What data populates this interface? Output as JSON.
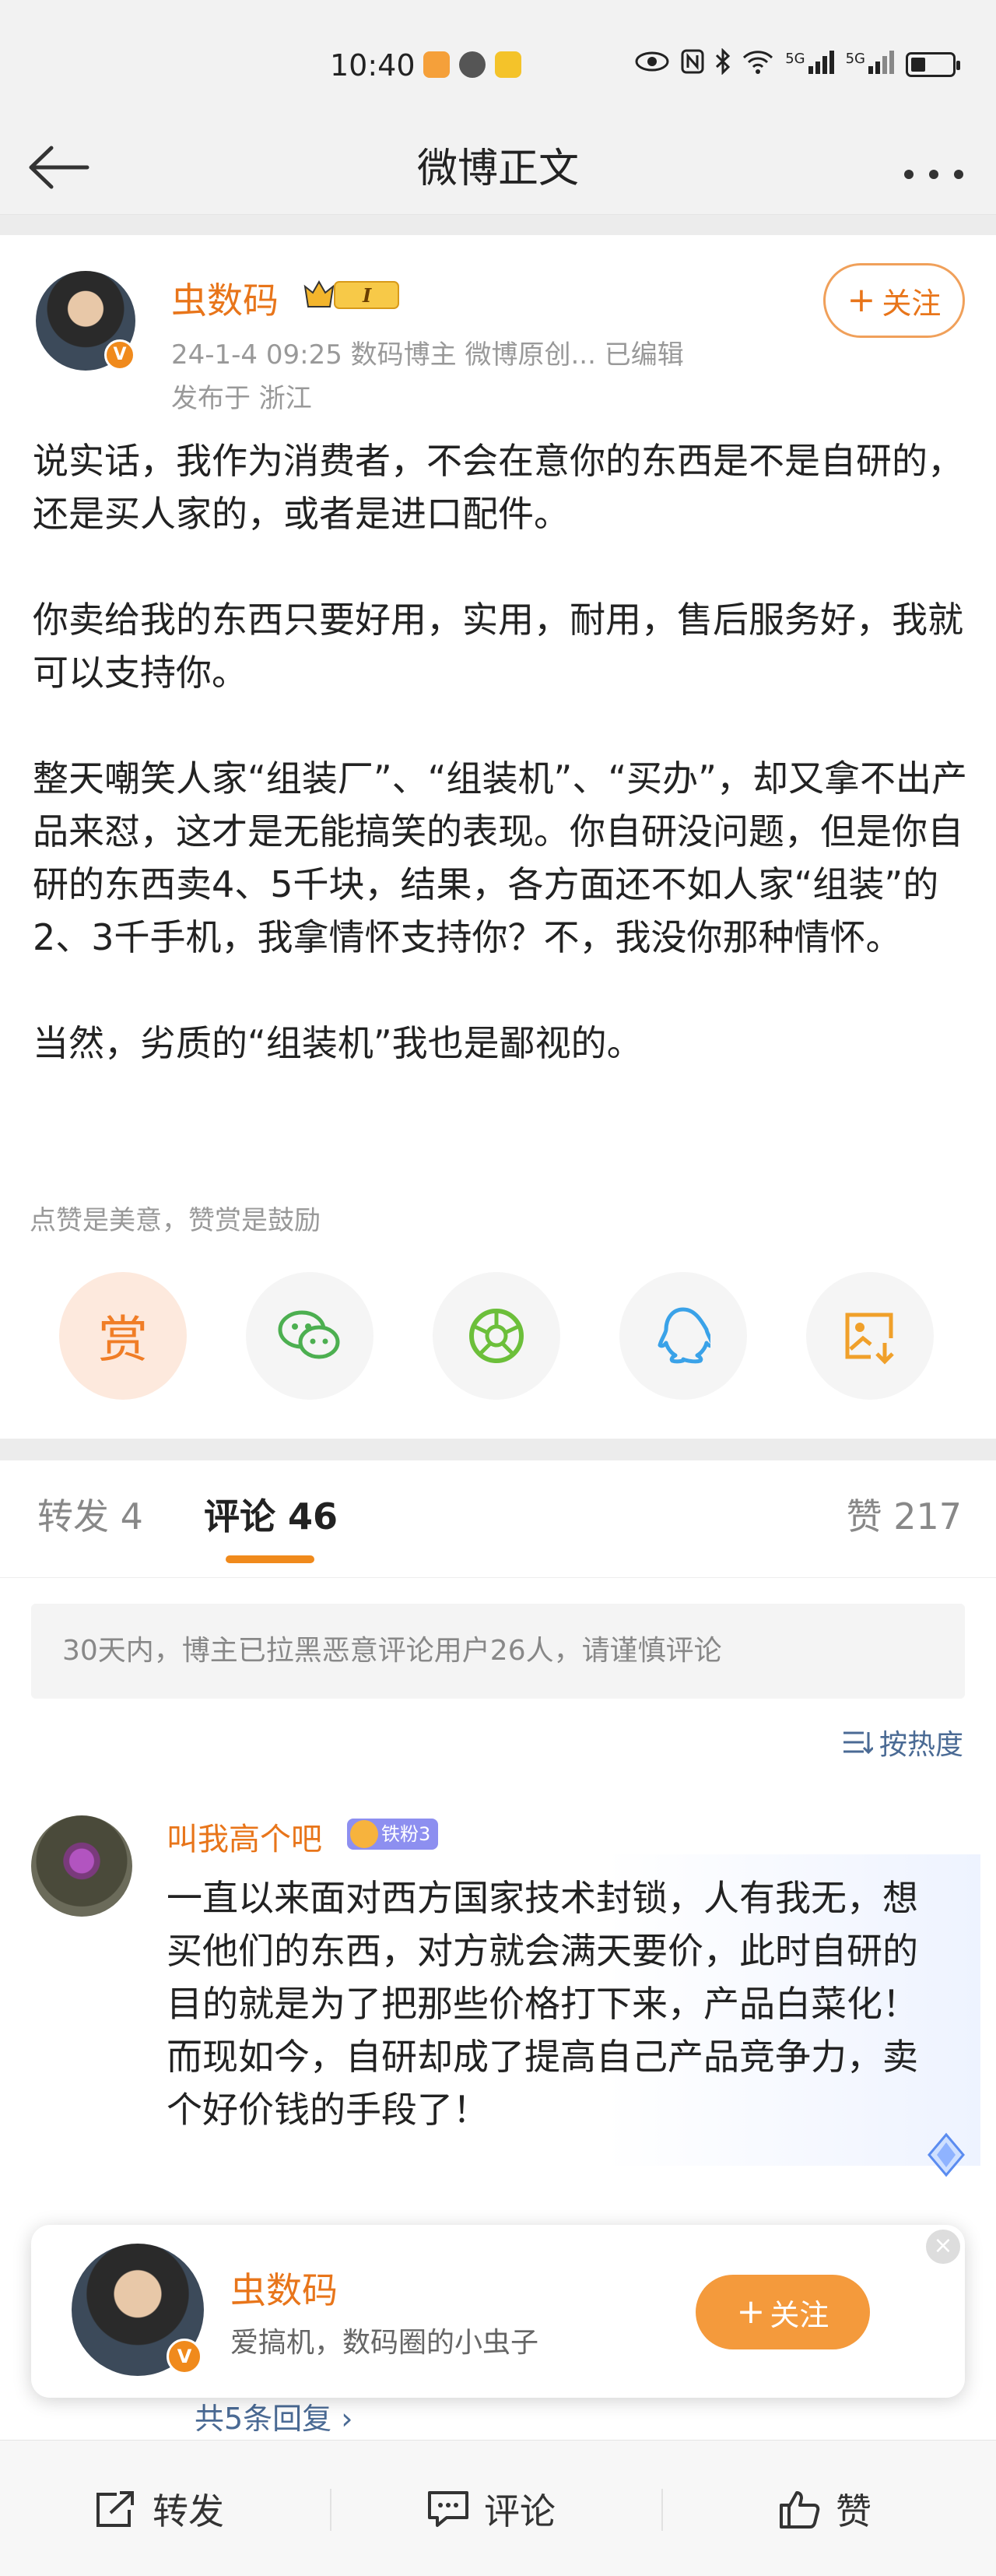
{
  "status_bar": {
    "time": "10:40",
    "network_labels": [
      "5G",
      "5G"
    ],
    "icons": [
      "app-orange-icon",
      "chat-bubble-icon",
      "mail-icon",
      "eye-icon",
      "nfc-icon",
      "bluetooth-icon",
      "wifi-icon",
      "signal-icon",
      "signal-icon",
      "battery-icon"
    ]
  },
  "nav": {
    "title": "微博正文",
    "back_icon": "arrow-left-icon",
    "more_icon": "more-dots-icon"
  },
  "post": {
    "author": "虫数码",
    "level_badge": "I",
    "meta": "24-1-4 09:25   数码博主 微博原创...   已编辑",
    "location": "发布于 浙江",
    "follow_label": "关注",
    "paragraphs": [
      "说实话，我作为消费者，不会在意你的东西是不是自研的，还是买人家的，或者是进口配件。",
      "你卖给我的东西只要好用，实用，耐用，售后服务好，我就可以支持你。",
      "整天嘲笑人家“组装厂”、“组装机”、“买办”，却又拿不出产品来怼，这才是无能搞笑的表现。你自研没问题，但是你自研的东西卖4、5千块，结果，各方面还不如人家“组装”的2、3千手机，我拿情怀支持你？不，我没你那种情怀。",
      "当然，劣质的“组装机”我也是鄙视的。"
    ],
    "reward_tip": "点赞是美意，赞赏是鼓励",
    "reward_label": "赏"
  },
  "tabs": {
    "repost": "转发 4",
    "comments": "评论 46",
    "likes": "赞 217"
  },
  "comments_notice": "30天内，博主已拉黑恶意评论用户26人，请谨慎评论",
  "sort_label": "按热度",
  "comment": {
    "user": "叫我高个吧",
    "fan_badge": "铁粉3",
    "text": "一直以来面对西方国家技术封锁，人有我无，想买他们的东西，对方就会满天要价，此时自研的目的就是为了把那些价格打下来，产品白菜化！而现如今，自研却成了提高自己产品竞争力，卖个好价钱的手段了！",
    "replies": "共5条回复 ›"
  },
  "follow_card": {
    "name": "虫数码",
    "desc": "爱搞机，数码圈的小虫子",
    "follow_label": "关注"
  },
  "bottom_bar": {
    "repost": "转发",
    "comment": "评论",
    "like": "赞"
  },
  "colors": {
    "accent": "#f08a1c",
    "name": "#e8751a",
    "link": "#4a6a94"
  }
}
